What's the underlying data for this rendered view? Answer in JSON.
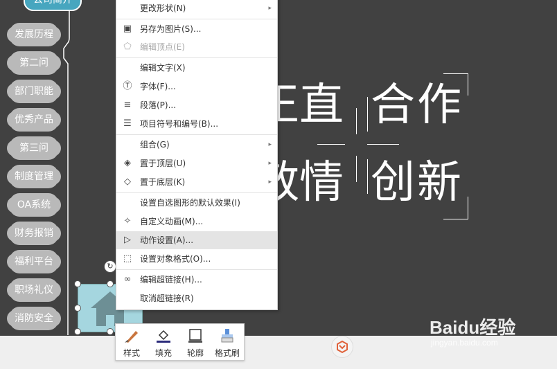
{
  "sidebar": {
    "top_item": "公司简介",
    "items": [
      "发展历程",
      "第二问",
      "部门职能",
      "优秀产品",
      "第三问",
      "制度管理",
      "OA系统",
      "财务报销",
      "福利平台",
      "职场礼仪",
      "消防安全"
    ]
  },
  "slide_text": {
    "row1": [
      "正",
      "直",
      "合",
      "作"
    ],
    "row2": [
      "敬",
      "情",
      "创",
      "新"
    ]
  },
  "context_menu": {
    "items": [
      {
        "label": "更改形状(N)",
        "icon": "",
        "submenu": true,
        "disabled": false
      },
      {
        "label": "另存为图片(S)...",
        "icon": "save-picture-icon",
        "disabled": false
      },
      {
        "label": "编辑顶点(E)",
        "icon": "edit-points-icon",
        "disabled": true
      },
      {
        "label": "编辑文字(X)",
        "icon": "",
        "disabled": false
      },
      {
        "label": "字体(F)...",
        "icon": "font-icon",
        "disabled": false
      },
      {
        "label": "段落(P)...",
        "icon": "paragraph-icon",
        "disabled": false
      },
      {
        "label": "项目符号和编号(B)...",
        "icon": "bullets-icon",
        "disabled": false
      },
      {
        "label": "组合(G)",
        "icon": "",
        "submenu": true,
        "disabled": false
      },
      {
        "label": "置于顶层(U)",
        "icon": "bring-front-icon",
        "submenu": true,
        "disabled": false
      },
      {
        "label": "置于底层(K)",
        "icon": "send-back-icon",
        "submenu": true,
        "disabled": false
      },
      {
        "label": "设置自选图形的默认效果(I)",
        "icon": "",
        "disabled": false
      },
      {
        "label": "自定义动画(M)...",
        "icon": "animation-icon",
        "disabled": false
      },
      {
        "label": "动作设置(A)...",
        "icon": "action-icon",
        "disabled": false,
        "highlighted": true
      },
      {
        "label": "设置对象格式(O)...",
        "icon": "format-object-icon",
        "disabled": false
      },
      {
        "label": "编辑超链接(H)...",
        "icon": "hyperlink-icon",
        "disabled": false
      },
      {
        "label": "取消超链接(R)",
        "icon": "",
        "disabled": false
      }
    ]
  },
  "mini_toolbar": {
    "style": "样式",
    "fill": "填充",
    "outline": "轮廓",
    "format_painter": "格式刷"
  },
  "watermark": {
    "brand": "Baidu经验",
    "url": "jingyan.baidu.com"
  }
}
